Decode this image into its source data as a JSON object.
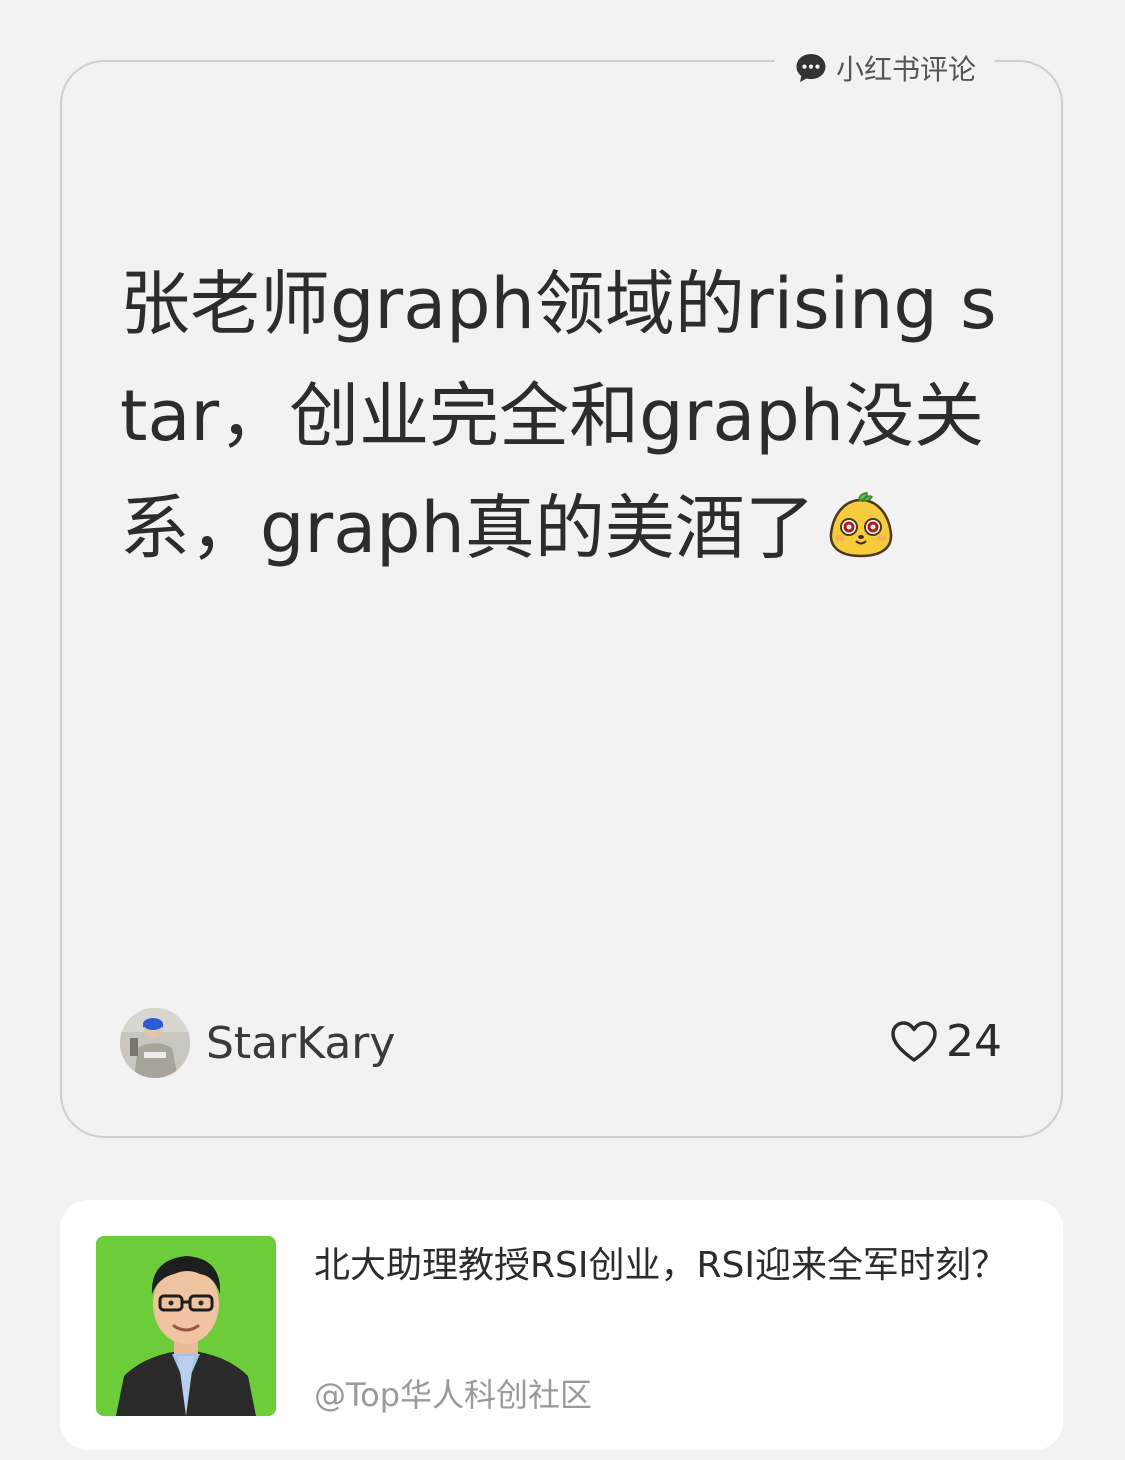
{
  "source_tag": {
    "label": "小红书评论",
    "icon": "chat-bubble-icon"
  },
  "comment": {
    "text": "张老师graph领域的rising star，创业完全和graph没关系，graph真的美酒了",
    "emoji": "cute-face-emoji"
  },
  "author": {
    "name": "StarKary",
    "avatar": "user-avatar"
  },
  "likes": {
    "icon": "heart-outline-icon",
    "count": "24"
  },
  "article": {
    "title": "北大助理教授RSI创业，RSI迎来全军时刻？",
    "source": "@Top华人科创社区",
    "thumbnail": "cartoon-portrait",
    "thumbnail_bg": "#6ccc3a"
  },
  "colors": {
    "background": "#f2f2f2",
    "text_primary": "#2c2c2c",
    "text_secondary": "#9a9a9a",
    "card_border": "#cfcfcf"
  }
}
